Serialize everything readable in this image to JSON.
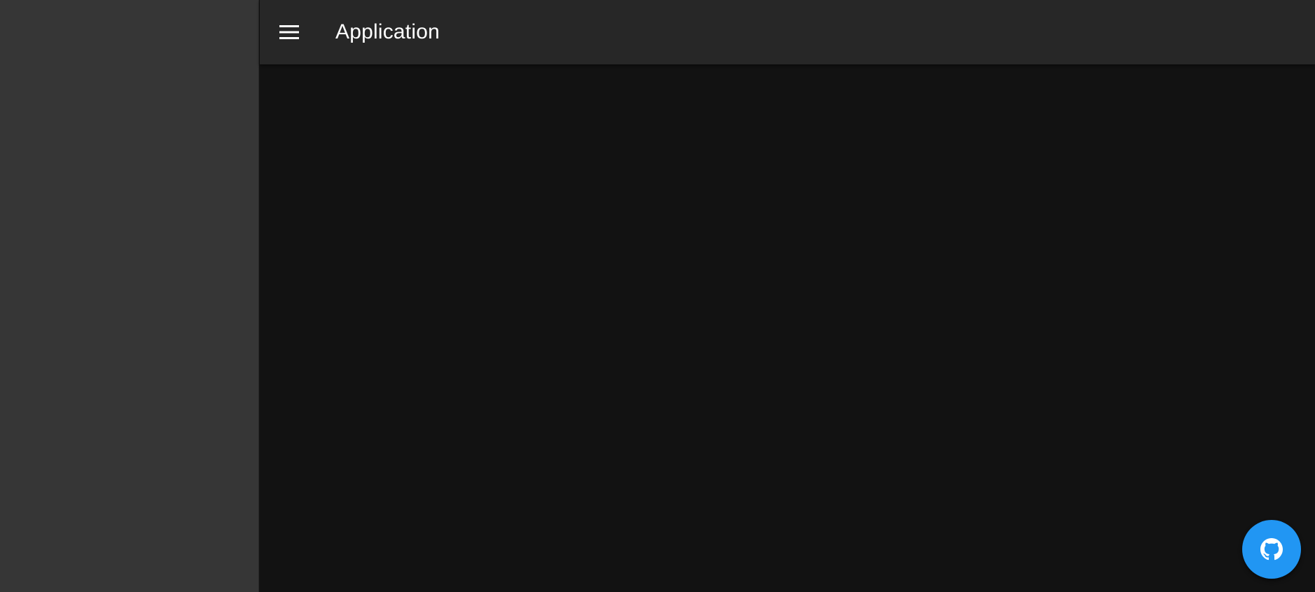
{
  "app_bar": {
    "title": "Application",
    "menu_icon": "hamburger-menu-icon"
  },
  "fab": {
    "icon": "github-icon",
    "color": "#2196f3"
  },
  "theme": {
    "drawer_bg": "#363636",
    "app_bar_bg": "#272727",
    "content_bg": "#121212"
  }
}
